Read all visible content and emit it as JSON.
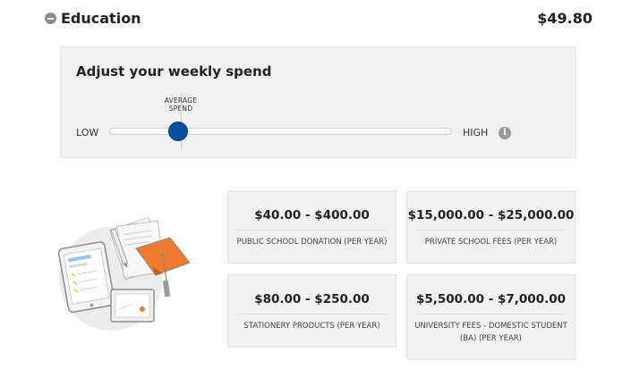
{
  "header": {
    "title": "Education",
    "amount": "$49.80"
  },
  "adjust": {
    "title": "Adjust your weekly spend",
    "low_label": "LOW",
    "high_label": "HIGH",
    "average_label": "AVERAGE\nSPEND",
    "slider_value_fraction": 0.2
  },
  "cards": [
    {
      "price": "$40.00 - $400.00",
      "description": "PUBLIC SCHOOL DONATION (PER YEAR)"
    },
    {
      "price": "$15,000.00 - $25,000.00",
      "description": "PRIVATE SCHOOL FEES (PER YEAR)"
    },
    {
      "price": "$80.00 - $250.00",
      "description": "STATIONERY PRODUCTS (PER YEAR)"
    },
    {
      "price": "$5,500.00 - $7,000.00",
      "description": "UNIVERSITY FEES - DOMESTIC STUDENT (BA) (PER YEAR)"
    }
  ],
  "icons": {
    "collapse": "minus-circle-icon",
    "info": "info-icon",
    "illustration": "education-illustration"
  },
  "colors": {
    "slider_thumb": "#0a4ea2",
    "cap": "#f07a2e",
    "panel_bg": "#f1f1f1"
  }
}
